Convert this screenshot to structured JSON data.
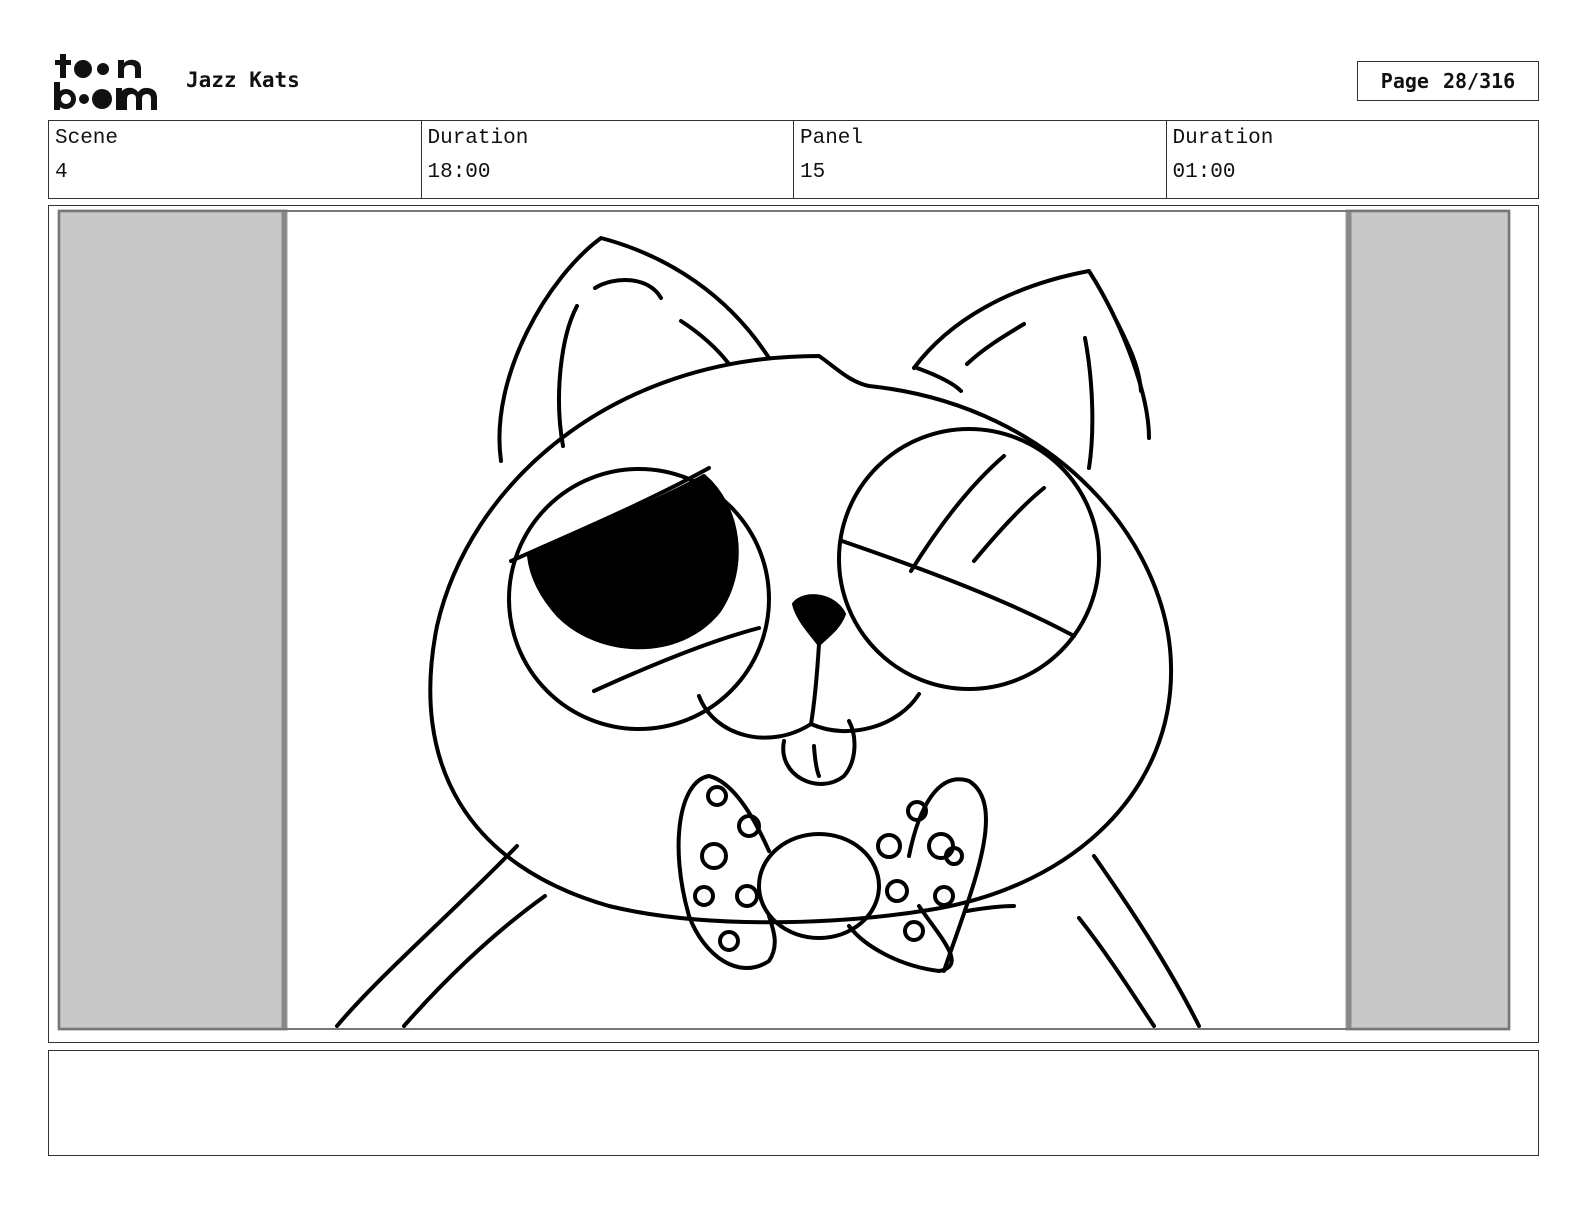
{
  "header": {
    "logo_icon": "toon-boom-logo",
    "project_title": "Jazz Kats",
    "page_label": "Page",
    "page_number": "28/316"
  },
  "info": {
    "scene_label": "Scene",
    "scene_value": "4",
    "scene_duration_label": "Duration",
    "scene_duration_value": "18:00",
    "panel_label": "Panel",
    "panel_value": "15",
    "panel_duration_label": "Duration",
    "panel_duration_value": "01:00"
  },
  "drawing": {
    "subject": "cat-with-bowtie-sketch",
    "letterbox_color": "#c8c8c8",
    "line_color": "#000000"
  },
  "notes": {
    "text": ""
  }
}
